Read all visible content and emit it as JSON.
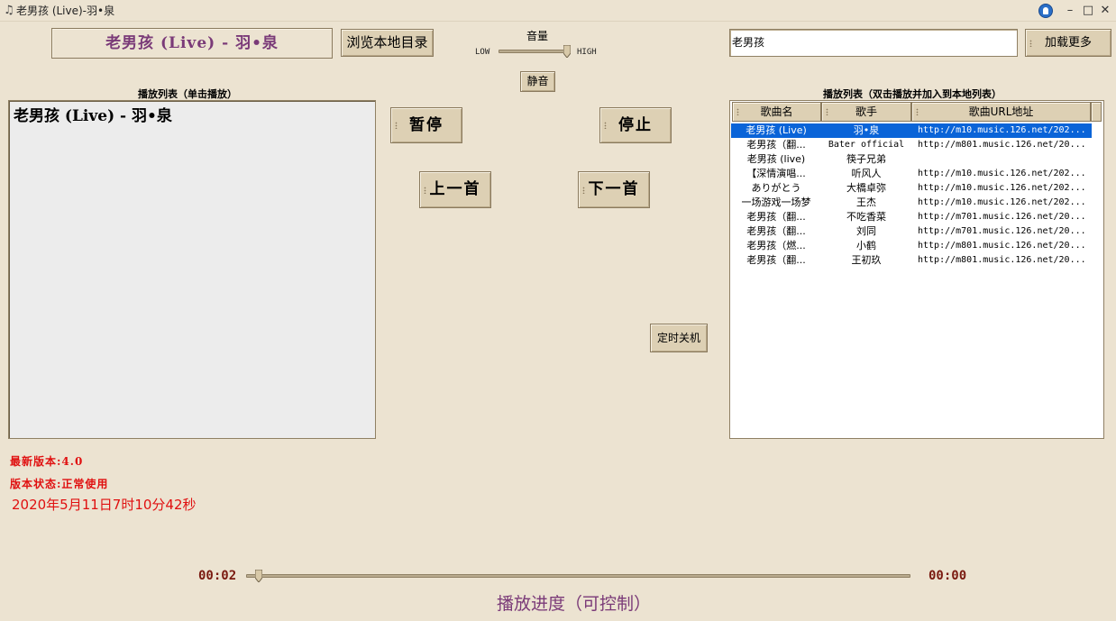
{
  "window": {
    "title": "老男孩 (Live)-羽•泉",
    "app_icon": "music-note-icon",
    "controls": {
      "minimize": "–",
      "maximize": "□",
      "close": "✕"
    }
  },
  "now_playing": "老男孩 (Live) - 羽•泉",
  "browse_button": "浏览本地目录",
  "volume": {
    "label": "音量",
    "low_label": "LOW",
    "high_label": "HIGH",
    "level": 0.95,
    "mute_button": "静音"
  },
  "search": {
    "value": "老男孩",
    "load_more_button": "加载更多"
  },
  "local_playlist": {
    "title": "播放列表（单击播放）",
    "items": [
      "老男孩 (Live) - 羽•泉"
    ]
  },
  "controls": {
    "pause": "暂停",
    "stop": "停止",
    "previous": "上一首",
    "next": "下一首",
    "shutdown_timer": "定时关机"
  },
  "online_playlist": {
    "title": "播放列表（双击播放并加入到本地列表）",
    "columns": [
      "歌曲名",
      "歌手",
      "歌曲URL地址"
    ],
    "selected_index": 0,
    "rows": [
      {
        "song": "老男孩 (Live)",
        "artist": "羽•泉",
        "url": "http://m10.music.126.net/202..."
      },
      {
        "song": "老男孩（翻...",
        "artist": "Bater official",
        "url": "http://m801.music.126.net/20..."
      },
      {
        "song": "老男孩 (live)",
        "artist": "筷子兄弟",
        "url": ""
      },
      {
        "song": "【深情演唱...",
        "artist": "听风人",
        "url": "http://m10.music.126.net/202..."
      },
      {
        "song": "ありがとう",
        "artist": "大橋卓弥",
        "url": "http://m10.music.126.net/202..."
      },
      {
        "song": "一场游戏一场梦",
        "artist": "王杰",
        "url": "http://m10.music.126.net/202..."
      },
      {
        "song": "老男孩（翻...",
        "artist": "不吃香菜",
        "url": "http://m701.music.126.net/20..."
      },
      {
        "song": "老男孩（翻...",
        "artist": "刘同",
        "url": "http://m701.music.126.net/20..."
      },
      {
        "song": "老男孩（燃...",
        "artist": "小鹤",
        "url": "http://m801.music.126.net/20..."
      },
      {
        "song": "老男孩（翻...",
        "artist": "王初玖",
        "url": "http://m801.music.126.net/20..."
      }
    ]
  },
  "status": {
    "latest_version": "最新版本:4.0",
    "version_state": "版本状态:正常使用",
    "datetime": "2020年5月11日7时10分42秒"
  },
  "progress": {
    "elapsed": "00:02",
    "total": "00:00",
    "fraction": 0.0,
    "label": "播放进度（可控制）"
  }
}
